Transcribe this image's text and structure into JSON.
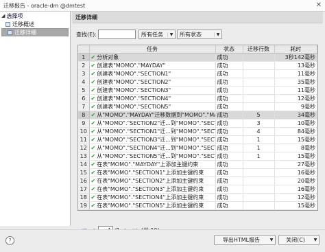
{
  "window": {
    "title": "迁移报告 - oracle-dm @dmtest"
  },
  "sidebar": {
    "root": "选择项",
    "items": [
      {
        "label": "迁移概述"
      },
      {
        "label": "迁移详细"
      }
    ]
  },
  "content": {
    "header": "迁移详细",
    "search_label": "查找(E):",
    "search_value": "",
    "filter_task": "所有任务",
    "filter_status": "所有状态"
  },
  "table": {
    "columns": [
      "",
      "任务",
      "状态",
      "迁移行数",
      "耗时"
    ],
    "rows": [
      {
        "n": "1",
        "task": "分析对象",
        "status": "成功",
        "count": "",
        "time": "3秒142毫秒"
      },
      {
        "n": "2",
        "task": "创建表\"MOMO\".\"MAYDAY\"",
        "status": "成功",
        "count": "",
        "time": "13毫秒"
      },
      {
        "n": "3",
        "task": "创建表\"MOMO\".\"SECTION1\"",
        "status": "成功",
        "count": "",
        "time": "11毫秒"
      },
      {
        "n": "4",
        "task": "创建表\"MOMO\".\"SECTION2\"",
        "status": "成功",
        "count": "",
        "time": "35毫秒"
      },
      {
        "n": "5",
        "task": "创建表\"MOMO\".\"SECTION3\"",
        "status": "成功",
        "count": "",
        "time": "11毫秒"
      },
      {
        "n": "6",
        "task": "创建表\"MOMO\".\"SECTION4\"",
        "status": "成功",
        "count": "",
        "time": "12毫秒"
      },
      {
        "n": "7",
        "task": "创建表\"MOMO\".\"SECTION5\"",
        "status": "成功",
        "count": "",
        "time": "9毫秒"
      },
      {
        "n": "8",
        "task": "从\"MOMO\".\"MAYDAY\"迁移数据到\"MOMO\".\"MAYDAY\"",
        "status": "成功",
        "count": "5",
        "time": "34毫秒"
      },
      {
        "n": "9",
        "task": "从\"MOMO\".\"SECTION2\"迁...到\"MOMO\".\"SECTION2\"",
        "status": "成功",
        "count": "3",
        "time": "10毫秒"
      },
      {
        "n": "10",
        "task": "从\"MOMO\".\"SECTION1\"迁...到\"MOMO\".\"SECTION1\"",
        "status": "成功",
        "count": "4",
        "time": "84毫秒"
      },
      {
        "n": "11",
        "task": "从\"MOMO\".\"SECTION3\"迁...到\"MOMO\".\"SECTION3\"",
        "status": "成功",
        "count": "1",
        "time": "15毫秒"
      },
      {
        "n": "12",
        "task": "从\"MOMO\".\"SECTION4\"迁...到\"MOMO\".\"SECTION4\"",
        "status": "成功",
        "count": "1",
        "time": "8毫秒"
      },
      {
        "n": "13",
        "task": "从\"MOMO\".\"SECTION5\"迁...到\"MOMO\".\"SECTION5\"",
        "status": "成功",
        "count": "1",
        "time": "15毫秒"
      },
      {
        "n": "14",
        "task": "在表\"MOMO\".\"MAYDAY\"上添加主键约束",
        "status": "成功",
        "count": "",
        "time": "27毫秒"
      },
      {
        "n": "15",
        "task": "在表\"MOMO\".\"SECTION1\"上添加主键约束",
        "status": "成功",
        "count": "",
        "time": "16毫秒"
      },
      {
        "n": "16",
        "task": "在表\"MOMO\".\"SECTION2\"上添加主键约束",
        "status": "成功",
        "count": "",
        "time": "20毫秒"
      },
      {
        "n": "17",
        "task": "在表\"MOMO\".\"SECTION3\"上添加主键约束",
        "status": "成功",
        "count": "",
        "time": "16毫秒"
      },
      {
        "n": "18",
        "task": "在表\"MOMO\".\"SECTION4\"上添加主键约束",
        "status": "成功",
        "count": "",
        "time": "12毫秒"
      },
      {
        "n": "19",
        "task": "在表\"MOMO\".\"SECTION5\"上添加主键约束",
        "status": "成功",
        "count": "",
        "time": "15毫秒"
      }
    ]
  },
  "pager": {
    "page": "1",
    "total_pages": "/1",
    "total": "(共 19)"
  },
  "footer": {
    "export_label": "导出HTML报告",
    "close_label": "关闭(C)"
  },
  "colors": {
    "check": "#2aa02a",
    "selection": "#a8a8a8"
  },
  "icons": {
    "check": "check-icon",
    "help": "help-icon",
    "close": "close-icon"
  }
}
